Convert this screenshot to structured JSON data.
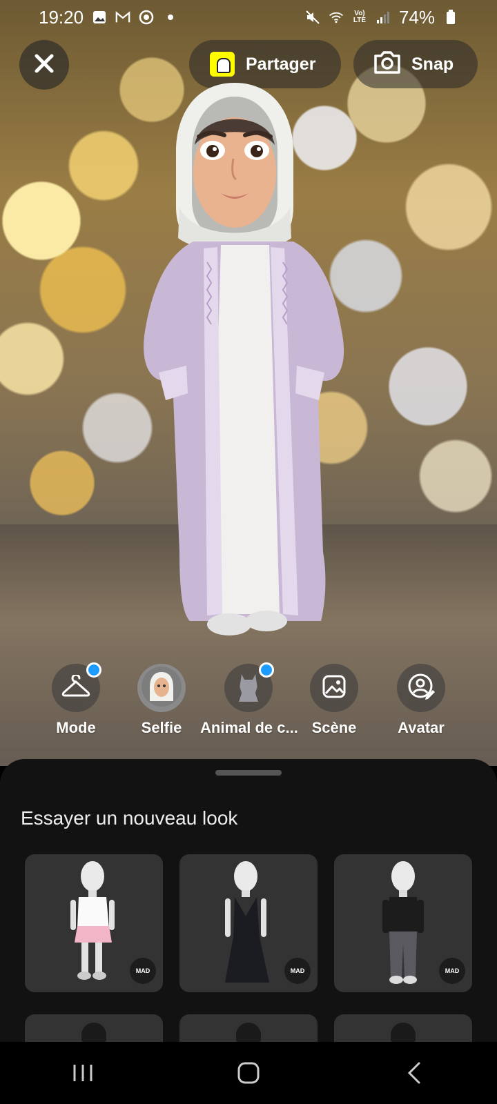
{
  "status_bar": {
    "time": "19:20",
    "battery": "74%",
    "icons": [
      "gallery-icon",
      "gmail-icon",
      "chrome-icon",
      "mute-icon",
      "wifi-icon",
      "volte-icon",
      "signal-icon",
      "battery-icon"
    ]
  },
  "top_bar": {
    "close_icon": "close-icon",
    "share_label": "Partager",
    "snap_label": "Snap"
  },
  "features": [
    {
      "label": "Mode",
      "icon": "hanger-icon",
      "badge": true
    },
    {
      "label": "Selfie",
      "icon": "selfie-icon",
      "badge": false
    },
    {
      "label": "Animal de c...",
      "icon": "pet-icon",
      "badge": true
    },
    {
      "label": "Scène",
      "icon": "scene-icon",
      "badge": false
    },
    {
      "label": "Avatar",
      "icon": "avatar-edit-icon",
      "badge": false
    }
  ],
  "sheet": {
    "title": "Essayer un nouveau look",
    "cards": [
      {
        "badge": "MAD",
        "outfit": "white-top-pink-skirt"
      },
      {
        "badge": "MAD",
        "outfit": "black-sequin-gown"
      },
      {
        "badge": "MAD",
        "outfit": "black-jacket-ripped-jeans"
      }
    ]
  },
  "colors": {
    "accent_badge": "#1e9bff",
    "snapcode": "#fffc00",
    "sheet_bg": "#121212",
    "card_bg": "#333333"
  }
}
